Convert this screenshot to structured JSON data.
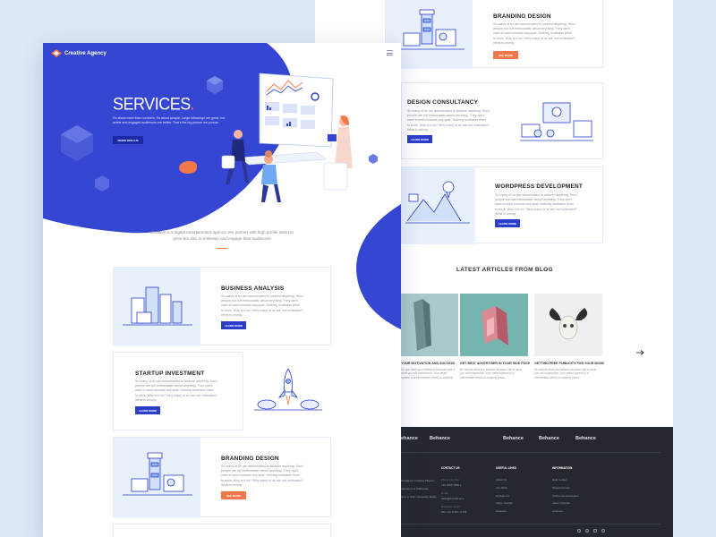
{
  "colors": {
    "brand_blue": "#3446d2",
    "orange": "#f27849",
    "navy_button": "#2a3ec9",
    "footer_bg": "#25282e"
  },
  "front": {
    "logo_text": "Creative Agency",
    "menu_icon": "hamburger-icon",
    "hero": {
      "title": "SERVICES",
      "body": "It's about more than numbers. It's about people. Large followings are great, but active and engaged audiences are better. That's the big picture we pursue.",
      "button": "WORK WITH US"
    },
    "intro": "Creative is a digital entertainment agency. We partner with high profile talent to grow but also to entertain and engage their audiences",
    "cards": [
      {
        "title": "BUSINESS ANALYSIS",
        "body": "So many of us are demotivated to achieve anything. Such people are not enthusiastic about anything. They don't want to work towards any goal. Nothing motivates them to work. Why is it so? Why many of us are not motivated? What is wrong.",
        "button": "LEARN MORE"
      },
      {
        "title": "STARTUP INVESTMENT",
        "body": "So many of us are demotivated to achieve anything. Such people are not enthusiastic about anything. They don't want to work towards any goal. Nothing motivates them to work. Why is it so? Why many of us are not motivated? What is wrong.",
        "button": "LEARN MORE"
      },
      {
        "title": "BRANDING DESIGN",
        "body": "So many of us are demotivated to achieve anything. Such people are not enthusiastic about anything. They don't want to work towards any goal. Nothing motivates them to work. Why is it so? Why many of us are not motivated? What is wrong.",
        "button": "SEE MORE"
      }
    ]
  },
  "back": {
    "cards": [
      {
        "title": "BRANDING DESIGN",
        "body": "So many of us are demotivated to achieve anything. Such people are not enthusiastic about anything. They don't want to work towards any goal. Nothing motivates them to work. Why is it so? Why many of us are not motivated? What is wrong.",
        "button": "SEE MORE"
      },
      {
        "title": "DESIGN CONSULTANCY",
        "body": "So many of us are demotivated to achieve anything. Such people are not enthusiastic about anything. They don't want to work towards any goal. Nothing motivates them to work. Why is it so? Why many of us are not motivated? What is wrong.",
        "button": "LEARN MORE"
      },
      {
        "title": "WORDPRESS DEVELOPMENT",
        "body": "So many of us are demotivated to achieve anything. Such people are not enthusiastic about anything. They don't want to work towards any goal. Nothing motivates them to work. Why is it so? Why many of us are not motivated? What is wrong.",
        "button": "LEARN MORE"
      }
    ],
    "articles_title": "LATEST ARTICLES FROM BLOG",
    "articles": [
      {
        "caption": "YOUR MOTIVATION AND SUCCESS",
        "body": "Do you think your beliefs is because that is what you will experience. Your belief system is a mechanism which is uniquely yours."
      },
      {
        "caption": "GET BEST ADVERTISER IN YOUR SIDE POCKET",
        "body": "Be careful what you believe because that is what you will experience. Your belief system is a mechanism which is uniquely yours."
      },
      {
        "caption": "GETTING FREE PUBLICITY FOR YOUR BUSINESS",
        "body": "Be careful what you believe because that is what you will experience. Your belief system is a mechanism which is uniquely yours."
      }
    ],
    "next_arrow": "arrow-right-icon",
    "footer": {
      "behance": [
        "Behance",
        "Behance",
        "Behance",
        "Behance",
        "Behance"
      ],
      "col1": [
        "Google for Creative Players",
        "Industry is a Difference",
        "How to Start Campaign Easily"
      ],
      "contact_head": "CONTACT US",
      "contact": [
        "Phone Number",
        "+91 0000 7890 1",
        "Email",
        "hello@domain.com",
        "Business Hours",
        "Mon–Fri 9 AM - 6 PM"
      ],
      "useful_head": "USEFUL LINKS",
      "useful": [
        "About Us",
        "Our Work",
        "Contact Us",
        "Video Tutorial",
        "Licenses"
      ],
      "info_head": "INFORMATION",
      "info": [
        "Help Center",
        "Support Forum",
        "Online Documentation",
        "Video Tutorials",
        "Licenses"
      ],
      "social_icons": [
        "facebook-icon",
        "twitter-icon",
        "instagram-icon",
        "behance-icon"
      ]
    }
  }
}
